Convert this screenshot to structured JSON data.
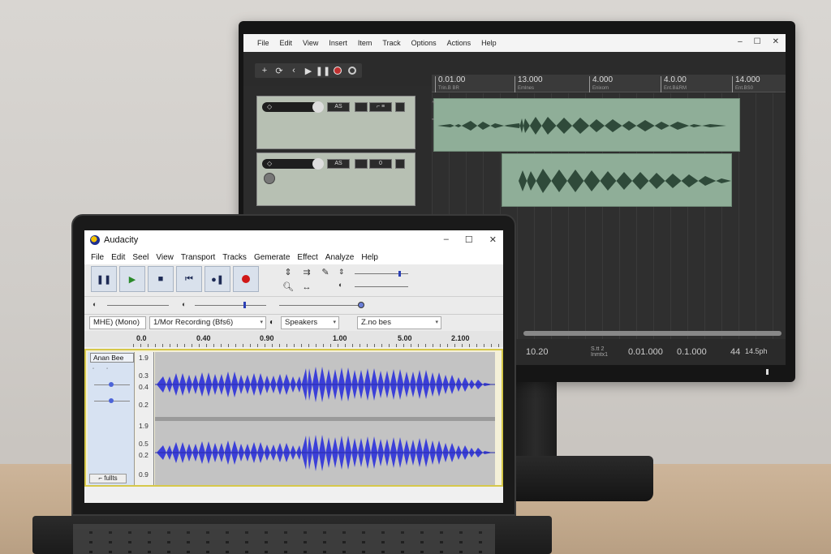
{
  "monitor": {
    "menu": [
      "File",
      "Edit",
      "View",
      "Insert",
      "Item",
      "Track",
      "Options",
      "Actions",
      "Help"
    ],
    "window_controls": [
      "–",
      "☐",
      "✕"
    ],
    "ruler": [
      {
        "value": "0.01.00",
        "sub": "Trin.B BR"
      },
      {
        "value": "13.000",
        "sub": "Emlnes"
      },
      {
        "value": "4.000",
        "sub": "Enixom"
      },
      {
        "value": "4.0.00",
        "sub": "Ent.B&RM"
      },
      {
        "value": "14.000",
        "sub": "Ent.BS0"
      }
    ],
    "track_headers": [
      {
        "icon": "◇",
        "btn1": "AS",
        "btn2": "⌐ ≡"
      },
      {
        "icon": "◇",
        "btn1": "AS",
        "btn2": "0"
      }
    ],
    "status": {
      "left": "10.20",
      "mid_small": [
        "S.tt 2",
        "Inmtx1"
      ],
      "v1": "0.01.000",
      "v2": "0.1.000",
      "v3": "44",
      "v4": "14.5ph"
    }
  },
  "laptop": {
    "app_title": "Audacity",
    "window_controls": [
      "–",
      "☐",
      "✕"
    ],
    "menu": [
      "File",
      "Edit",
      "Seel",
      "View",
      "Transport",
      "Tracks",
      "Gemerate",
      "Effect",
      "Analyze",
      "Help"
    ],
    "devices": {
      "host": "MHE) (Mono)",
      "recording": "1/Mor Recording (Bfs6)",
      "playback": "Speakers",
      "channels": "Z.no bes"
    },
    "timeline": [
      "0.0",
      "0.40",
      "0.90",
      "1.00",
      "5.00",
      "2.100"
    ],
    "track": {
      "name": "Anan Bee",
      "full_button": "fullts",
      "scale_top": [
        "1.9",
        "0.3",
        "0.4",
        "0.2"
      ],
      "scale_bottom": [
        "1.9",
        "0.5",
        "0.2",
        "0.9"
      ]
    },
    "colors": {
      "waveform": "#3b3fd8",
      "record": "#d01818",
      "selection_border": "#d6c84a"
    }
  }
}
